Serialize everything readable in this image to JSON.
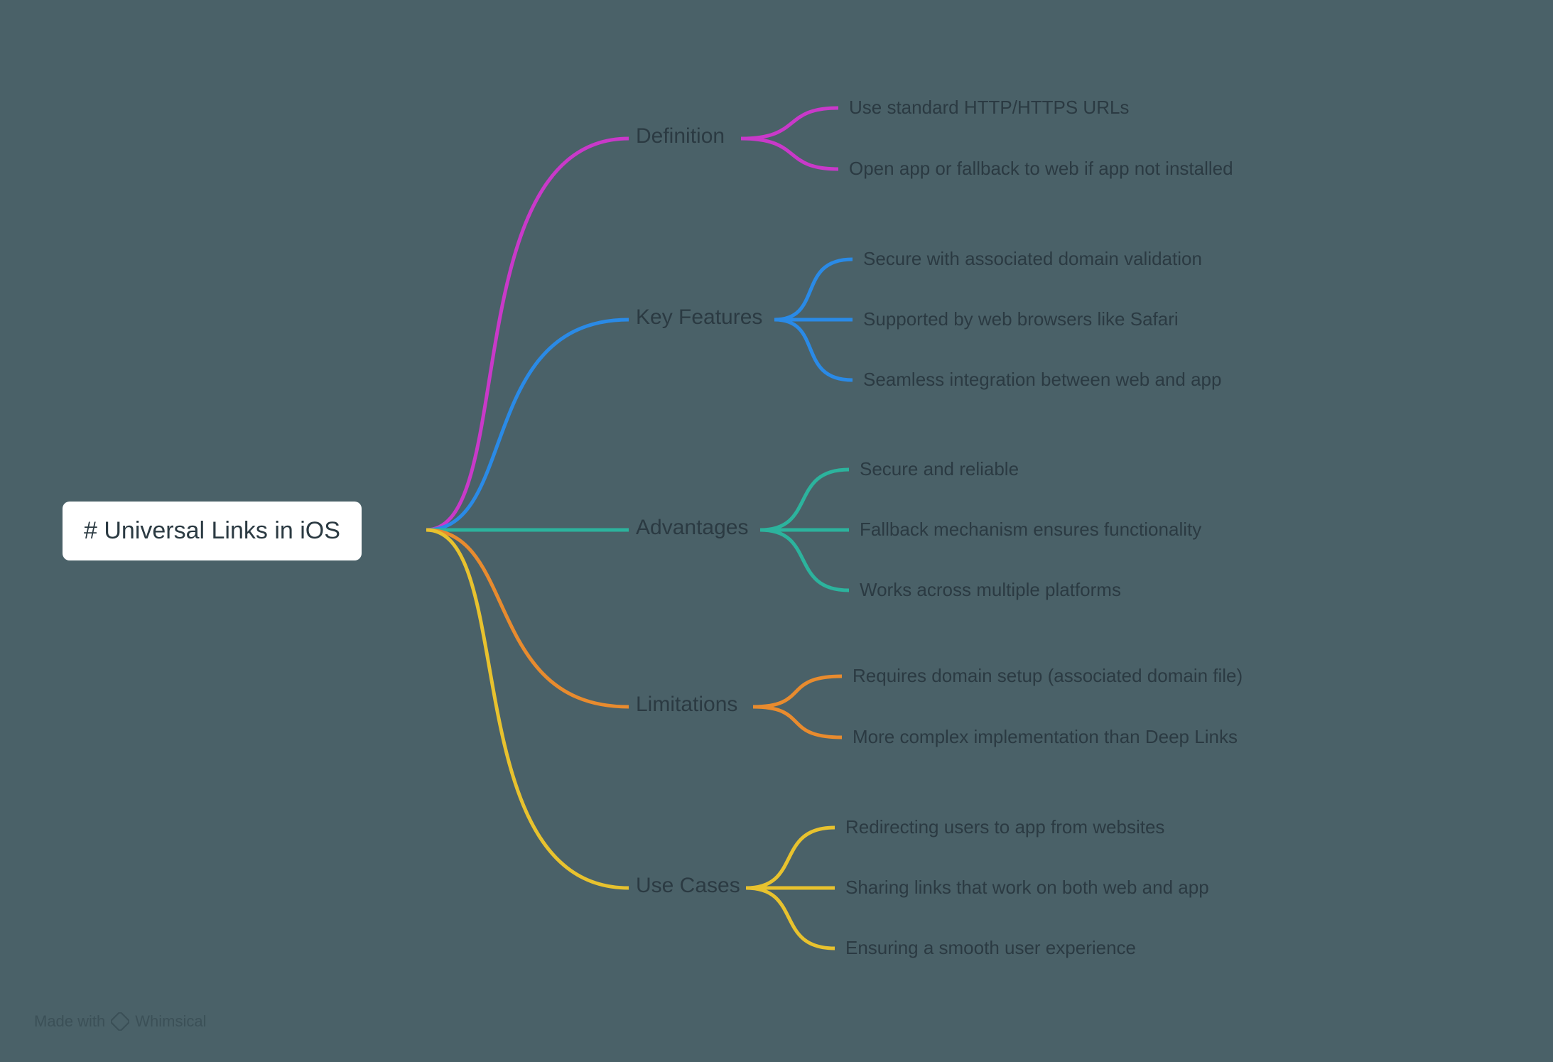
{
  "root": {
    "title": "# Universal Links in iOS"
  },
  "branches": [
    {
      "label": "Definition",
      "color": "#c939c9",
      "children": [
        "Use standard HTTP/HTTPS URLs",
        "Open app or fallback to web if app not installed"
      ]
    },
    {
      "label": "Key Features",
      "color": "#2a8ae6",
      "children": [
        "Secure with associated domain validation",
        "Supported by web browsers like Safari",
        "Seamless integration between web and app"
      ]
    },
    {
      "label": "Advantages",
      "color": "#2cb39d",
      "children": [
        "Secure and reliable",
        "Fallback mechanism ensures functionality",
        "Works across multiple platforms"
      ]
    },
    {
      "label": "Limitations",
      "color": "#e88b2e",
      "children": [
        "Requires domain setup (associated domain file)",
        "More complex implementation than Deep Links"
      ]
    },
    {
      "label": "Use Cases",
      "color": "#e8c22e",
      "children": [
        "Redirecting users to app from websites",
        "Sharing links that work on both web and app",
        "Ensuring a smooth user experience"
      ]
    }
  ],
  "watermark": {
    "prefix": "Made with",
    "brand": "Whimsical"
  }
}
